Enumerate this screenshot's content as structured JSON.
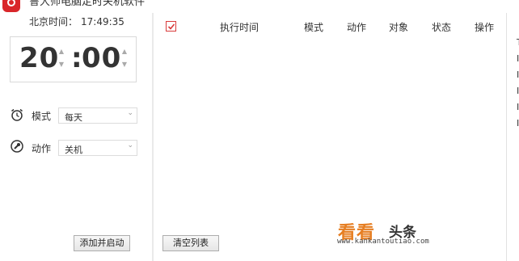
{
  "window": {
    "title": "鲁大师电脑定时关机软件",
    "minimize_glyph": "—"
  },
  "left": {
    "beijing_time_label": "北京时间：",
    "beijing_time_value": "17:49:35",
    "clock": {
      "hour": "20",
      "colon": ":",
      "minute": "00"
    },
    "mode_label": "模式",
    "mode_value": "每天",
    "action_label": "动作",
    "action_value": "关机",
    "add_start_button": "添加并启动"
  },
  "table": {
    "checked": true,
    "columns": [
      "执行时间",
      "模式",
      "动作",
      "对象",
      "状态",
      "操作"
    ],
    "rows": [],
    "clear_button": "清空列表"
  },
  "right_edge_text": [
    "T",
    "I",
    "I",
    "I",
    "I",
    "I"
  ],
  "watermark": {
    "main": "看看",
    "secondary": "头条",
    "url": "www.kankantoutiao.com"
  },
  "colors": {
    "accent_red": "#d9262a",
    "watermark_orange": "#e67e22"
  }
}
